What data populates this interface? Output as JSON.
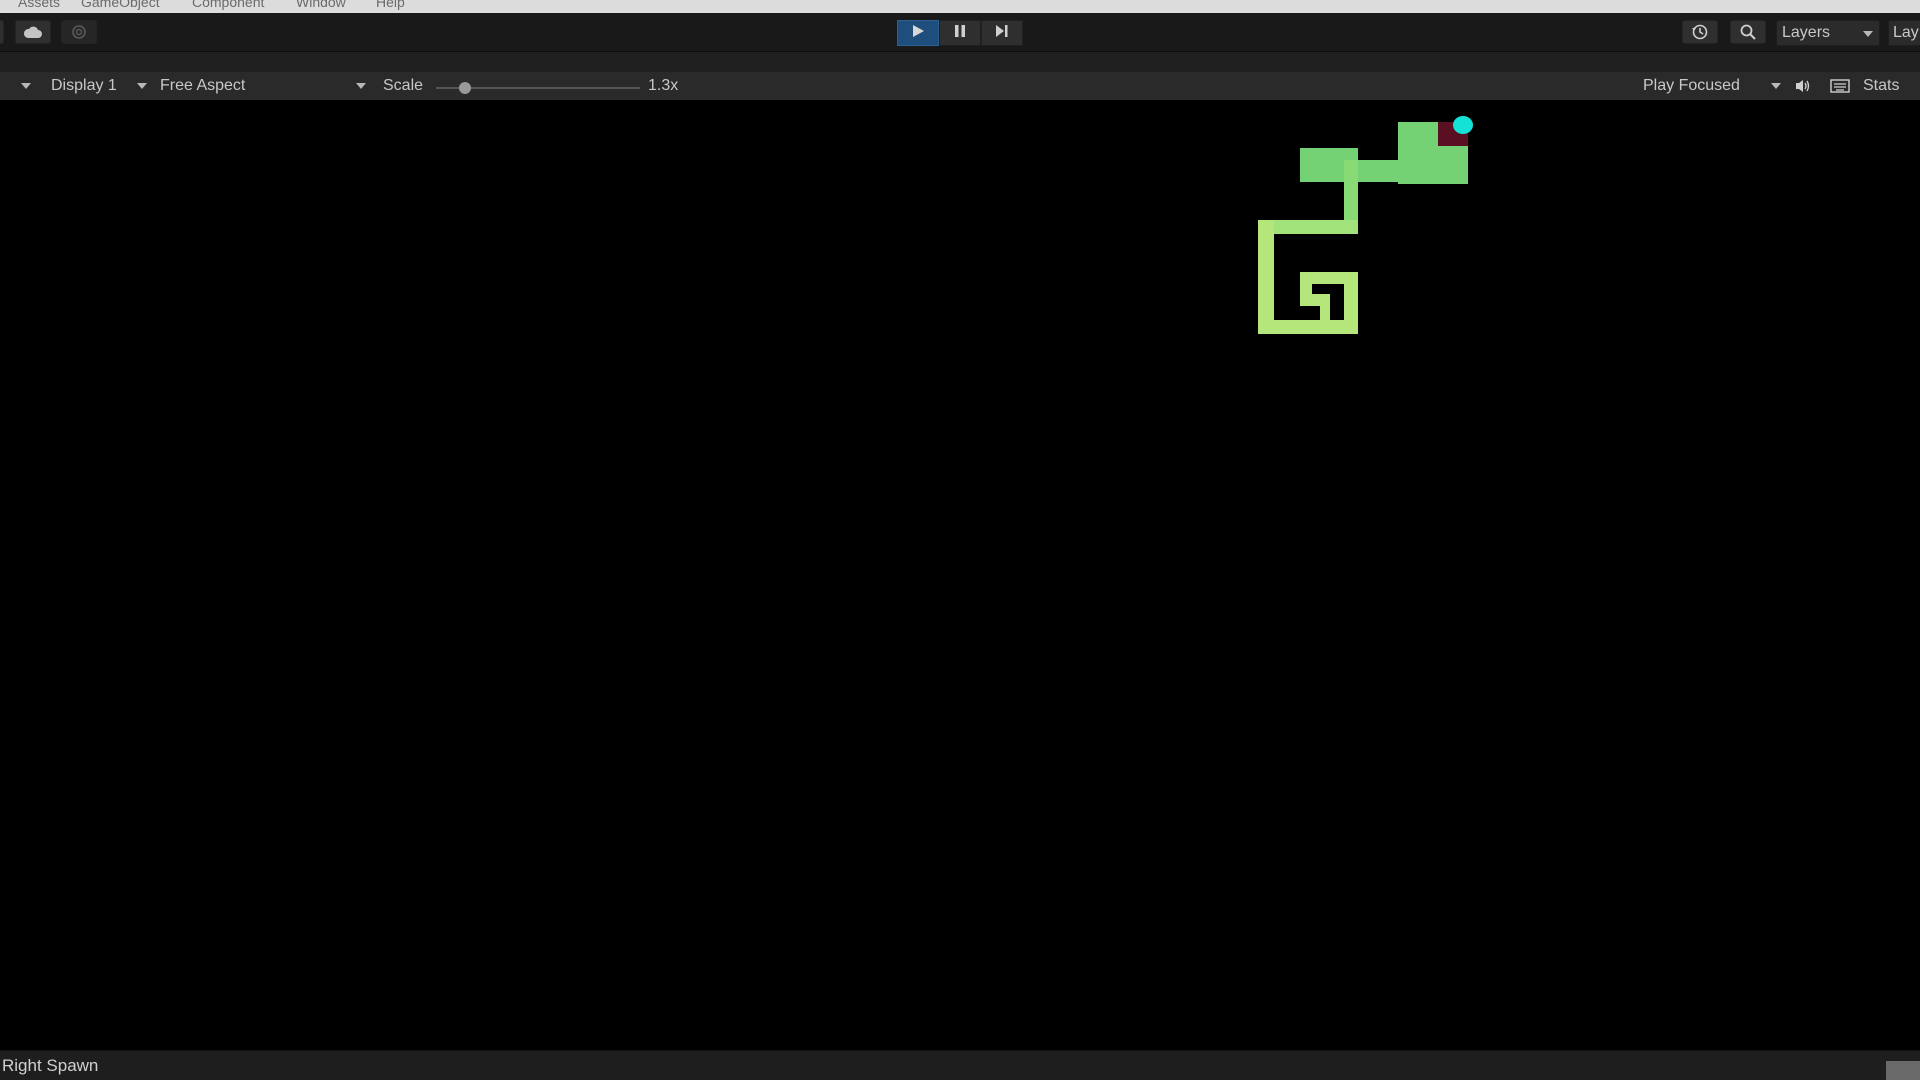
{
  "menu": {
    "items": [
      "Assets",
      "GameObject",
      "Component",
      "Window",
      "Help"
    ]
  },
  "toolbar": {
    "icons": [
      "cloud-icon",
      "collab-icon",
      "play-icon",
      "pause-icon",
      "step-icon",
      "history-icon",
      "search-icon"
    ],
    "layers_label": "Layers",
    "layout_label": "Lay",
    "play_active": true
  },
  "game_toolbar": {
    "display": "Display 1",
    "aspect": "Free Aspect",
    "scale_label": "Scale",
    "scale_value": "1.3x",
    "scale_fraction": 0.14,
    "play_mode": "Play Focused",
    "stats_label": "Stats",
    "icons": [
      "speaker-icon",
      "keyboard-icon"
    ]
  },
  "game": {
    "colors": {
      "light_floor": "#b5e67c",
      "mid_floor": "#7fd672",
      "dark_floor": "#6ccd7a",
      "goal": "#5a0f22",
      "player": "#14e2d6"
    }
  },
  "status": {
    "message": "Right Spawn"
  },
  "colors": {
    "play_active_bg": "#1f4d7c",
    "toolbar_bg": "#191919",
    "game_toolbar_bg": "#2a2a2a"
  }
}
